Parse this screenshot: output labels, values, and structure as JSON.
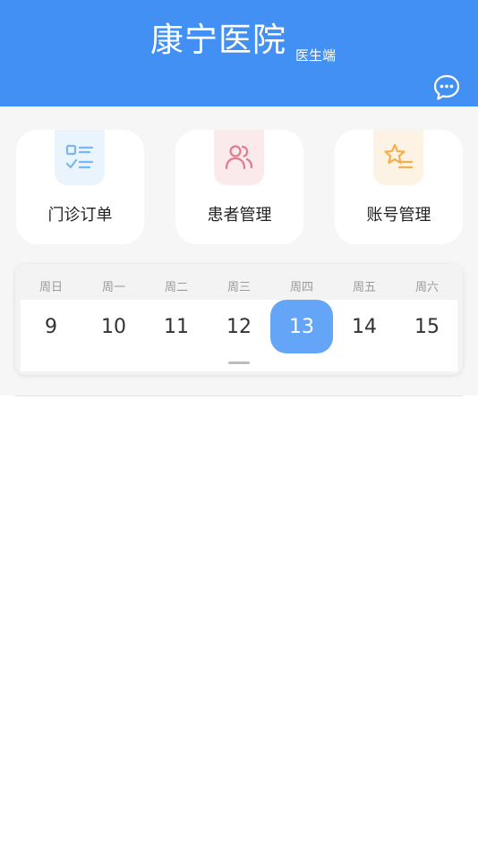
{
  "header": {
    "title": "康宁医院",
    "subtitle": "医生端",
    "message_icon": "chat-bubble-icon",
    "background_color": "#4290f3"
  },
  "menu": [
    {
      "label": "门诊订单",
      "icon": "order-list-icon",
      "color": "#7ab7ec",
      "bg": "#e9f4fd"
    },
    {
      "label": "患者管理",
      "icon": "patients-icon",
      "color": "#e07b8b",
      "bg": "#fbeaec"
    },
    {
      "label": "账号管理",
      "icon": "star-list-icon",
      "color": "#f3b14e",
      "bg": "#fdf3e4"
    }
  ],
  "calendar": {
    "weekdays": [
      "周日",
      "周一",
      "周二",
      "周三",
      "周四",
      "周五",
      "周六"
    ],
    "days": [
      "9",
      "10",
      "11",
      "12",
      "13",
      "14",
      "15"
    ],
    "selected_day": "13",
    "selected_color": "#64a5f7"
  }
}
